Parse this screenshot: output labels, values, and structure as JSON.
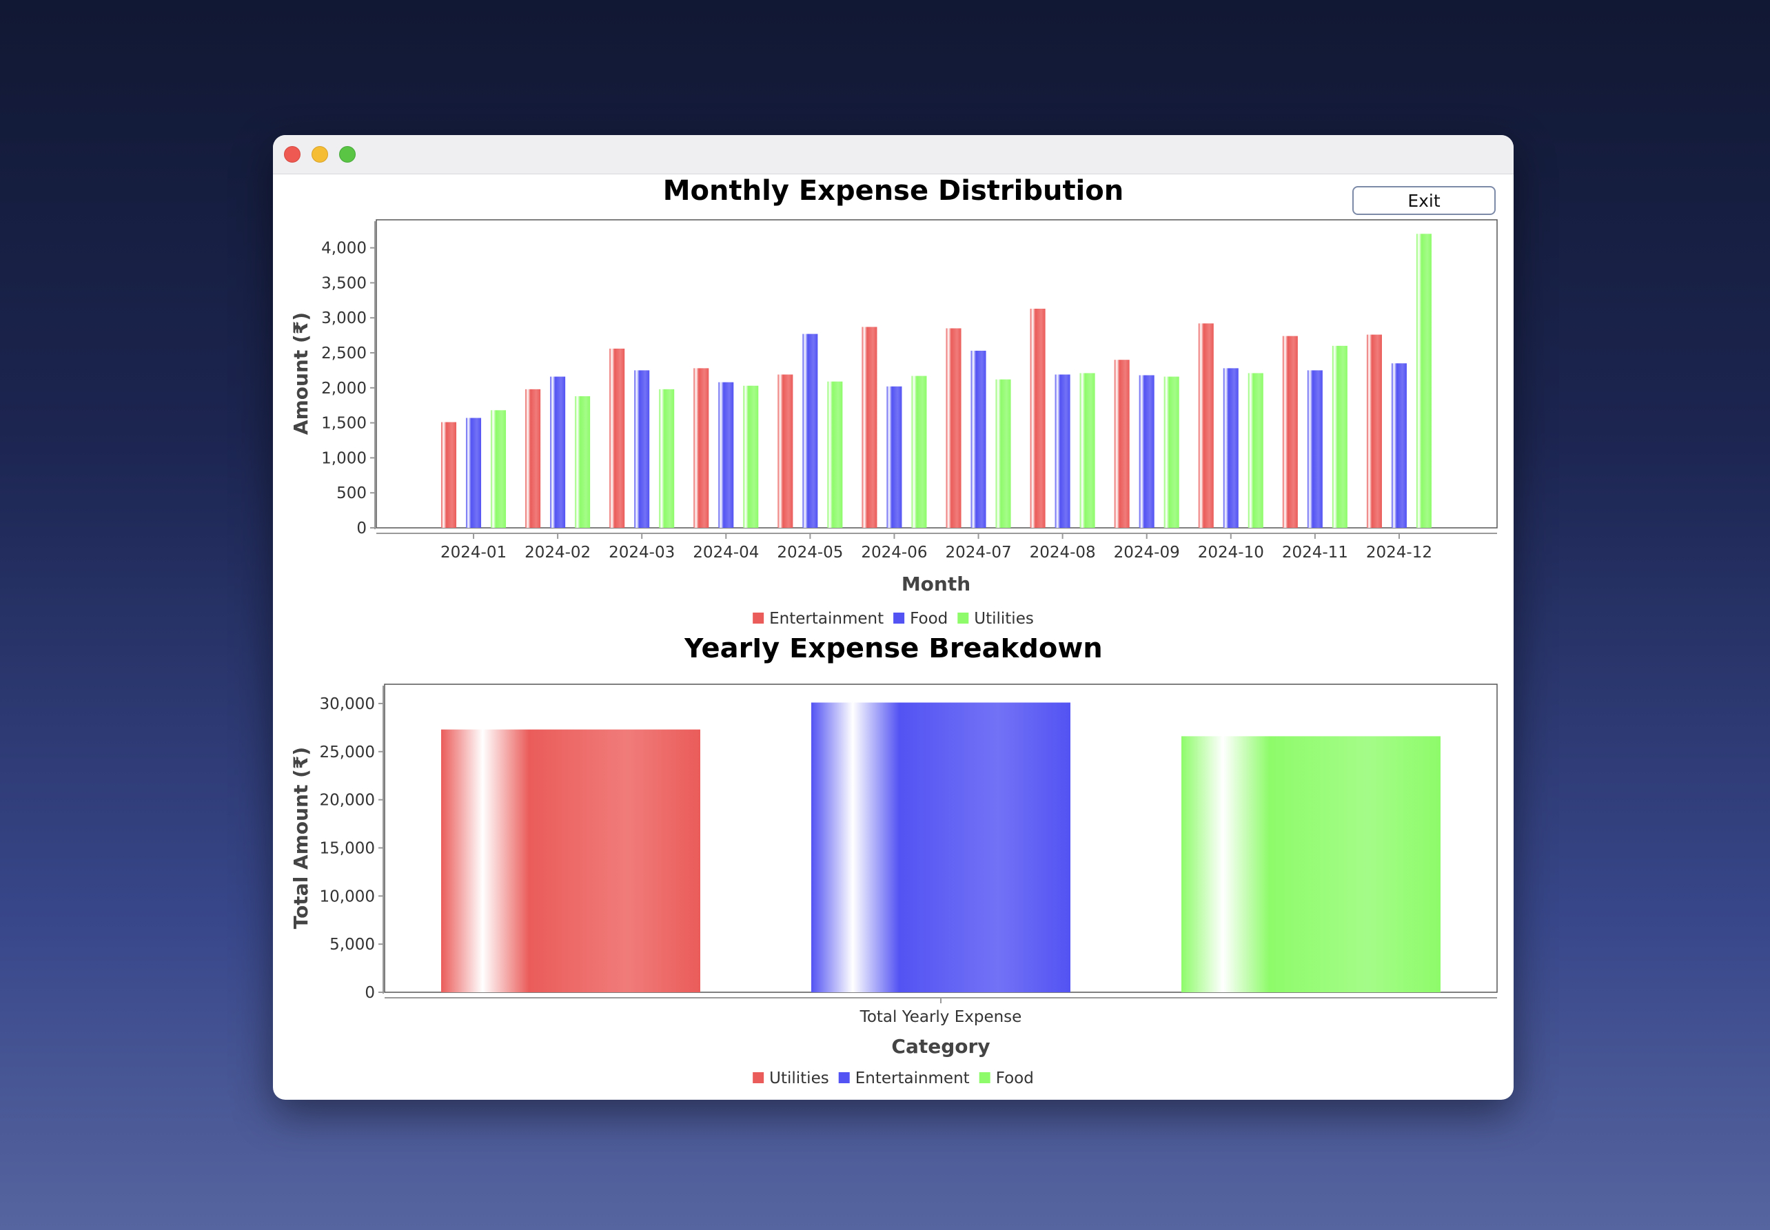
{
  "window": {
    "exit_label": "Exit"
  },
  "colors": {
    "red": "#ea5c5a",
    "blue": "#5353f3",
    "green": "#8efb6a"
  },
  "chart_data": [
    {
      "type": "bar",
      "title": "Monthly Expense Distribution",
      "xlabel": "Month",
      "ylabel": "Amount (₹)",
      "ylim": [
        0,
        4400
      ],
      "yticks": [
        0,
        500,
        1000,
        1500,
        2000,
        2500,
        3000,
        3500,
        4000
      ],
      "ytick_labels": [
        "0",
        "500",
        "1,000",
        "1,500",
        "2,000",
        "2,500",
        "3,000",
        "3,500",
        "4,000"
      ],
      "categories": [
        "2024-01",
        "2024-02",
        "2024-03",
        "2024-04",
        "2024-05",
        "2024-06",
        "2024-07",
        "2024-08",
        "2024-09",
        "2024-10",
        "2024-11",
        "2024-12"
      ],
      "series": [
        {
          "name": "Entertainment",
          "color": "#ea5c5a",
          "values": [
            1510,
            1980,
            2560,
            2280,
            2190,
            2870,
            2850,
            3130,
            2400,
            2920,
            2740,
            2760
          ]
        },
        {
          "name": "Food",
          "color": "#5353f3",
          "values": [
            1570,
            2160,
            2250,
            2080,
            2770,
            2020,
            2530,
            2190,
            2180,
            2280,
            2250,
            2350
          ]
        },
        {
          "name": "Utilities",
          "color": "#8efb6a",
          "values": [
            1680,
            1880,
            1980,
            2030,
            2090,
            2170,
            2120,
            2210,
            2160,
            2210,
            2600,
            4200
          ]
        }
      ],
      "legend": "bottom-center",
      "grid": false
    },
    {
      "type": "bar",
      "title": "Yearly Expense Breakdown",
      "xlabel": "Category",
      "ylabel": "Total Amount (₹)",
      "ylim": [
        0,
        32000
      ],
      "yticks": [
        0,
        5000,
        10000,
        15000,
        20000,
        25000,
        30000
      ],
      "ytick_labels": [
        "0",
        "5,000",
        "10,000",
        "15,000",
        "20,000",
        "25,000",
        "30,000"
      ],
      "categories": [
        "Total Yearly Expense"
      ],
      "series": [
        {
          "name": "Utilities",
          "color": "#ea5c5a",
          "values": [
            27300
          ]
        },
        {
          "name": "Entertainment",
          "color": "#5353f3",
          "values": [
            30100
          ]
        },
        {
          "name": "Food",
          "color": "#8efb6a",
          "values": [
            26600
          ]
        }
      ],
      "legend": "bottom-center",
      "grid": false
    }
  ]
}
